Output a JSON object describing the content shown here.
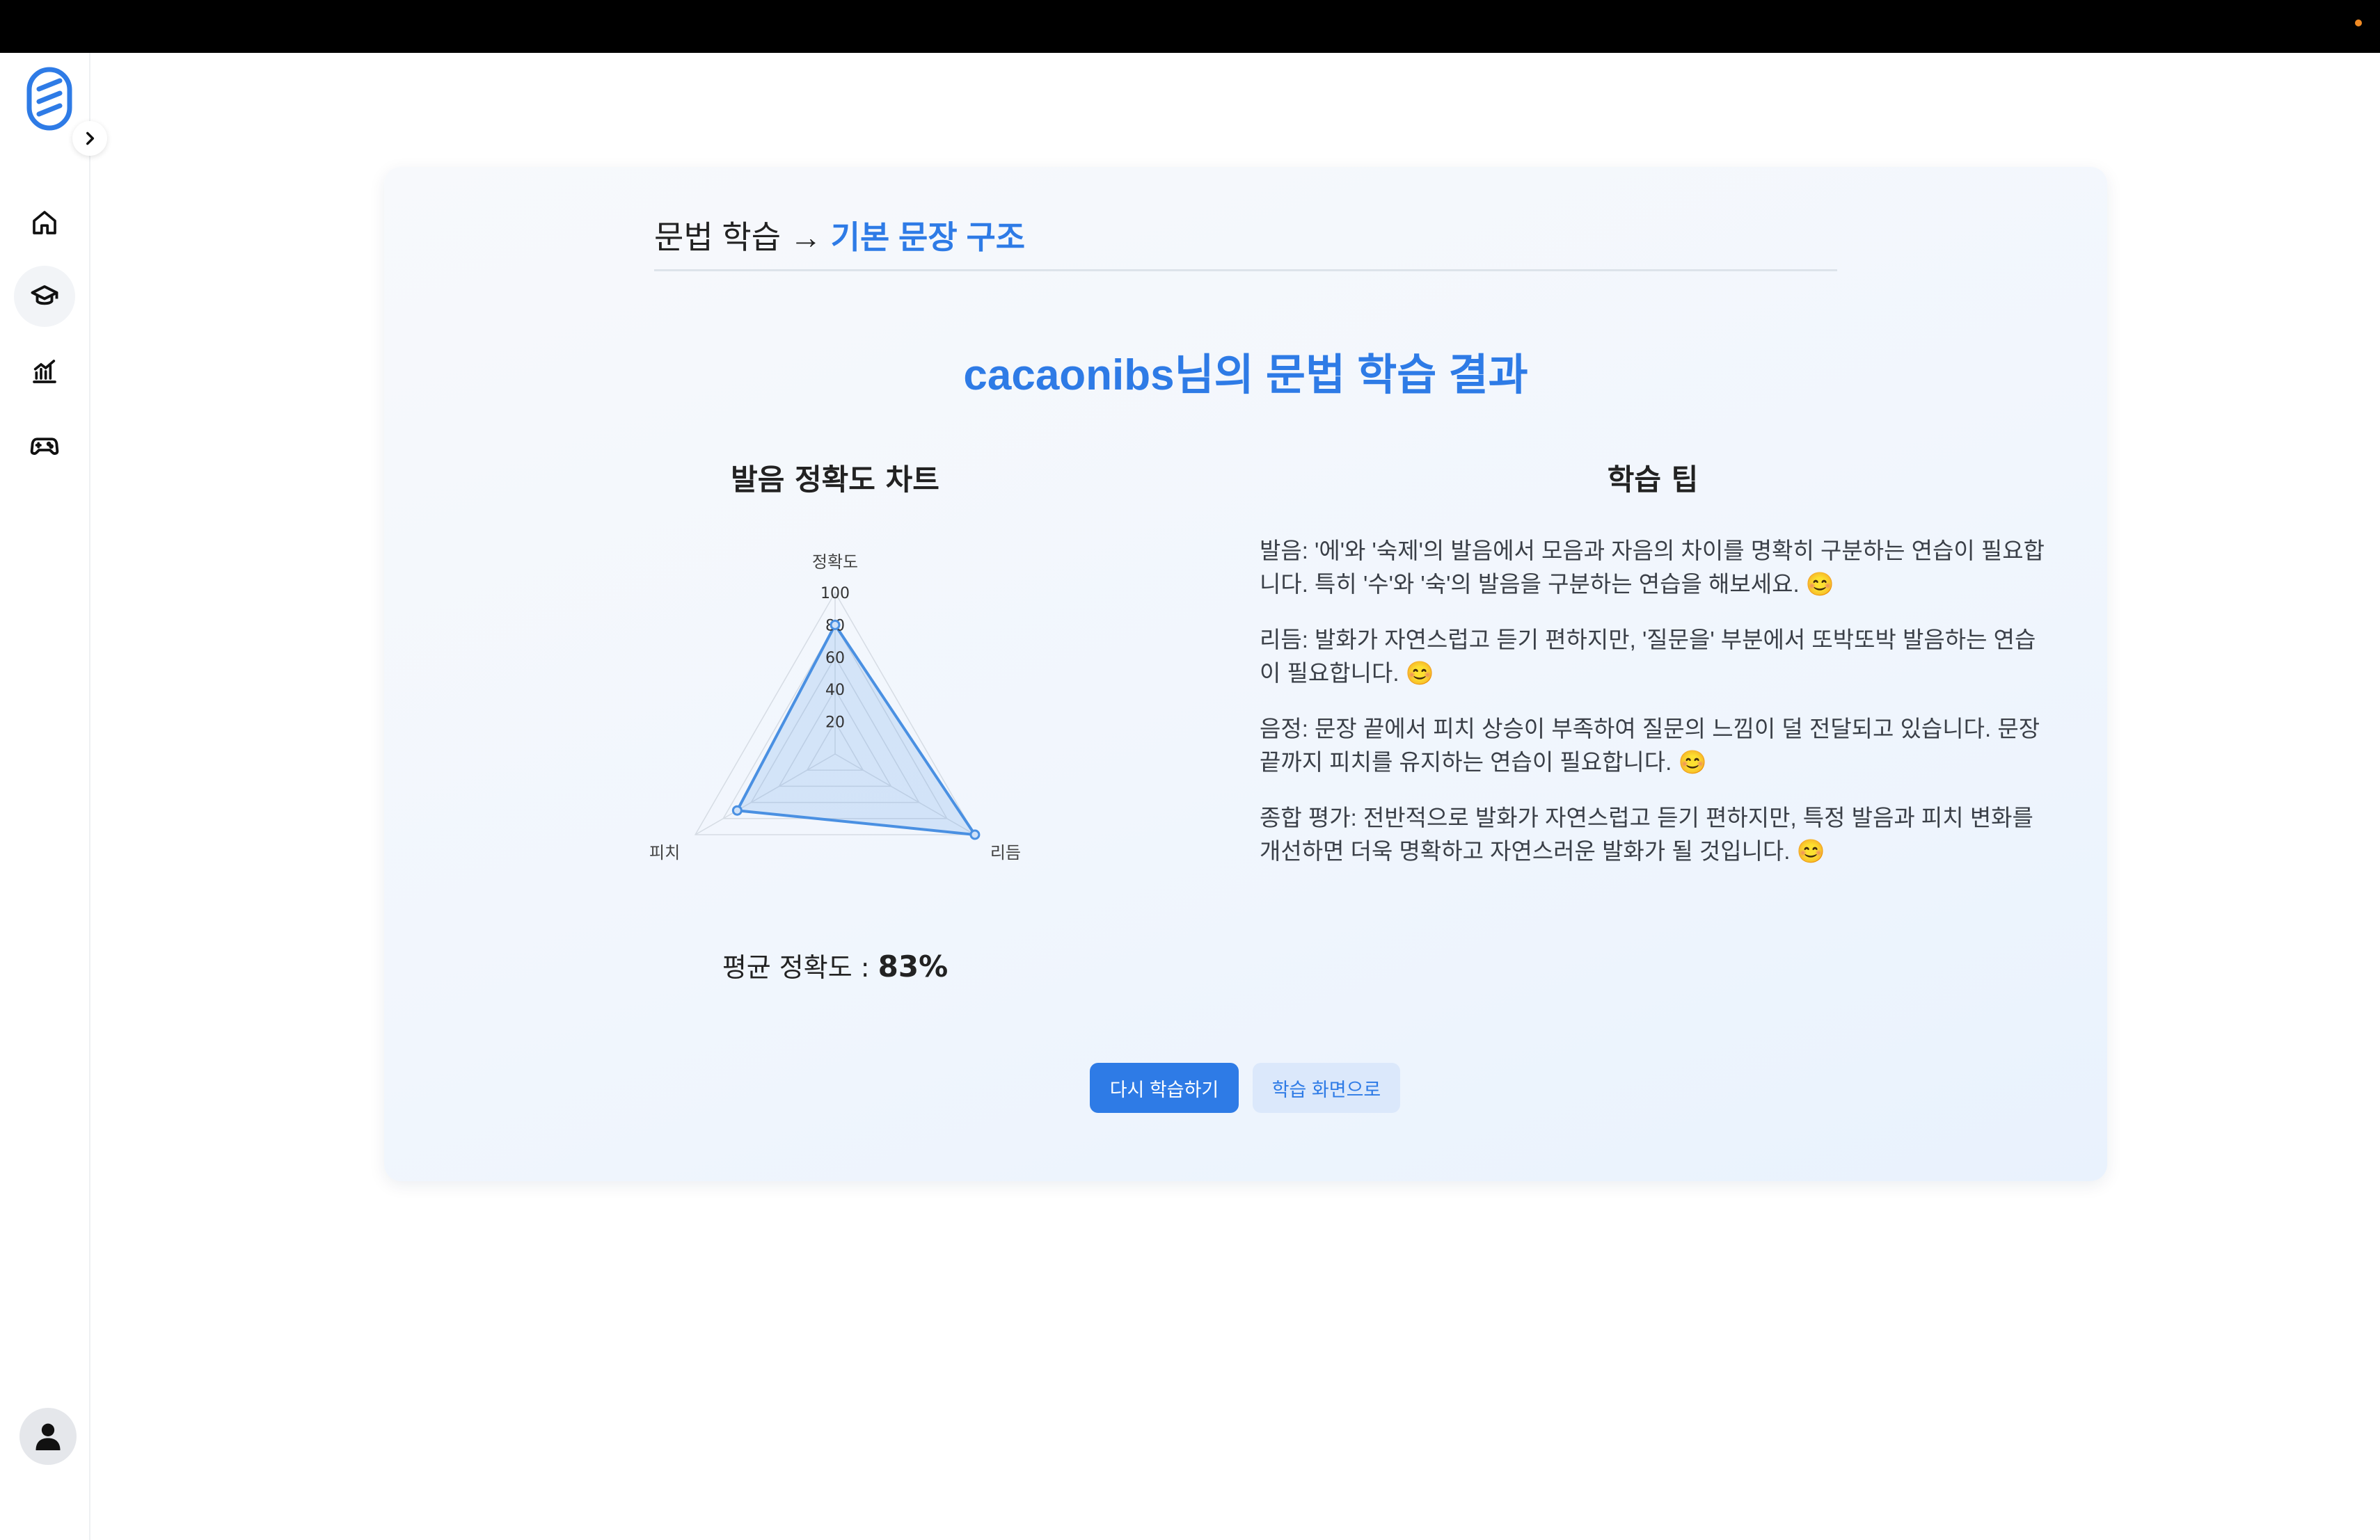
{
  "breadcrumb": {
    "parent": "문법 학습",
    "separator": " → ",
    "current": "기본 문장 구조"
  },
  "result": {
    "title": "cacaonibs님의 문법 학습 결과"
  },
  "chart_section": {
    "title": "발음 정확도 차트",
    "average_label": "평균 정확도 : ",
    "average_value": "83%"
  },
  "chart_data": {
    "type": "radar",
    "title": "발음 정확도 차트",
    "axes": [
      "정확도",
      "리듬",
      "피치"
    ],
    "values": [
      80,
      100,
      70
    ],
    "range": [
      0,
      100
    ],
    "ticks": [
      "20",
      "40",
      "60",
      "80",
      "100"
    ],
    "colors": {
      "line": "#4a90e2",
      "fill": "#4a90e2"
    }
  },
  "tips_section": {
    "title": "학습 팁",
    "items": [
      "발음: '에'와 '숙제'의 발음에서 모음과 자음의 차이를 명확히 구분하는 연습이 필요합니다. 특히 '수'와 '숙'의 발음을 구분하는 연습을 해보세요. 😊",
      "리듬: 발화가 자연스럽고 듣기 편하지만, '질문을' 부분에서 또박또박 발음하는 연습이 필요합니다. 😊",
      "음정: 문장 끝에서 피치 상승이 부족하여 질문의 느낌이 덜 전달되고 있습니다. 문장 끝까지 피치를 유지하는 연습이 필요합니다. 😊",
      "종합 평가: 전반적으로 발화가 자연스럽고 듣기 편하지만, 특정 발음과 피치 변화를 개선하면 더욱 명확하고 자연스러운 발화가 될 것입니다. 😊"
    ]
  },
  "buttons": {
    "retry": "다시 학습하기",
    "back": "학습 화면으로"
  },
  "icons": {
    "logo": "logo-icon",
    "collapse": "chevron-right-icon",
    "nav": [
      "home-icon",
      "graduation-cap-icon",
      "chart-icon",
      "gamepad-icon"
    ],
    "user": "user-icon"
  },
  "colors": {
    "accent": "#2e7be6",
    "topbar": "#000000",
    "status_dot": "#f08a24"
  }
}
